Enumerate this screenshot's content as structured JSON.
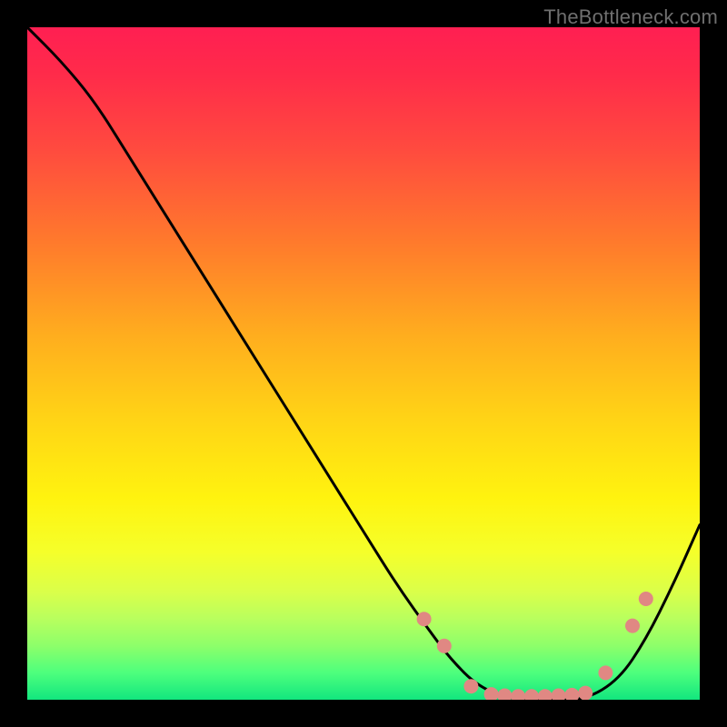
{
  "watermark": "TheBottleneck.com",
  "chart_data": {
    "type": "line",
    "title": "",
    "xlabel": "",
    "ylabel": "",
    "xlim": [
      0,
      100
    ],
    "ylim": [
      0,
      100
    ],
    "background_gradient": {
      "orientation": "vertical",
      "stops": [
        {
          "pos": 0,
          "color": "#ff1f52"
        },
        {
          "pos": 18,
          "color": "#ff4a3f"
        },
        {
          "pos": 46,
          "color": "#ffae1e"
        },
        {
          "pos": 70,
          "color": "#fff30f"
        },
        {
          "pos": 88,
          "color": "#b8ff5e"
        },
        {
          "pos": 100,
          "color": "#12e67e"
        }
      ]
    },
    "series": [
      {
        "name": "bottleneck-curve",
        "color": "#000000",
        "x": [
          0,
          5,
          10,
          15,
          20,
          25,
          30,
          35,
          40,
          45,
          50,
          55,
          60,
          63,
          67,
          72,
          78,
          83,
          88,
          92,
          96,
          100
        ],
        "y": [
          100,
          95,
          89,
          81,
          73,
          65,
          57,
          49,
          41,
          33,
          25,
          17,
          10,
          6,
          2,
          0,
          0,
          0,
          3,
          9,
          17,
          26
        ]
      }
    ],
    "markers": {
      "name": "highlight-points",
      "color": "#e08883",
      "radius_px": 8,
      "x": [
        59,
        62,
        66,
        69,
        71,
        73,
        75,
        77,
        79,
        81,
        83,
        86,
        90,
        92
      ],
      "y": [
        12,
        8,
        2,
        0.8,
        0.6,
        0.5,
        0.5,
        0.5,
        0.6,
        0.7,
        1,
        4,
        11,
        15
      ]
    }
  }
}
